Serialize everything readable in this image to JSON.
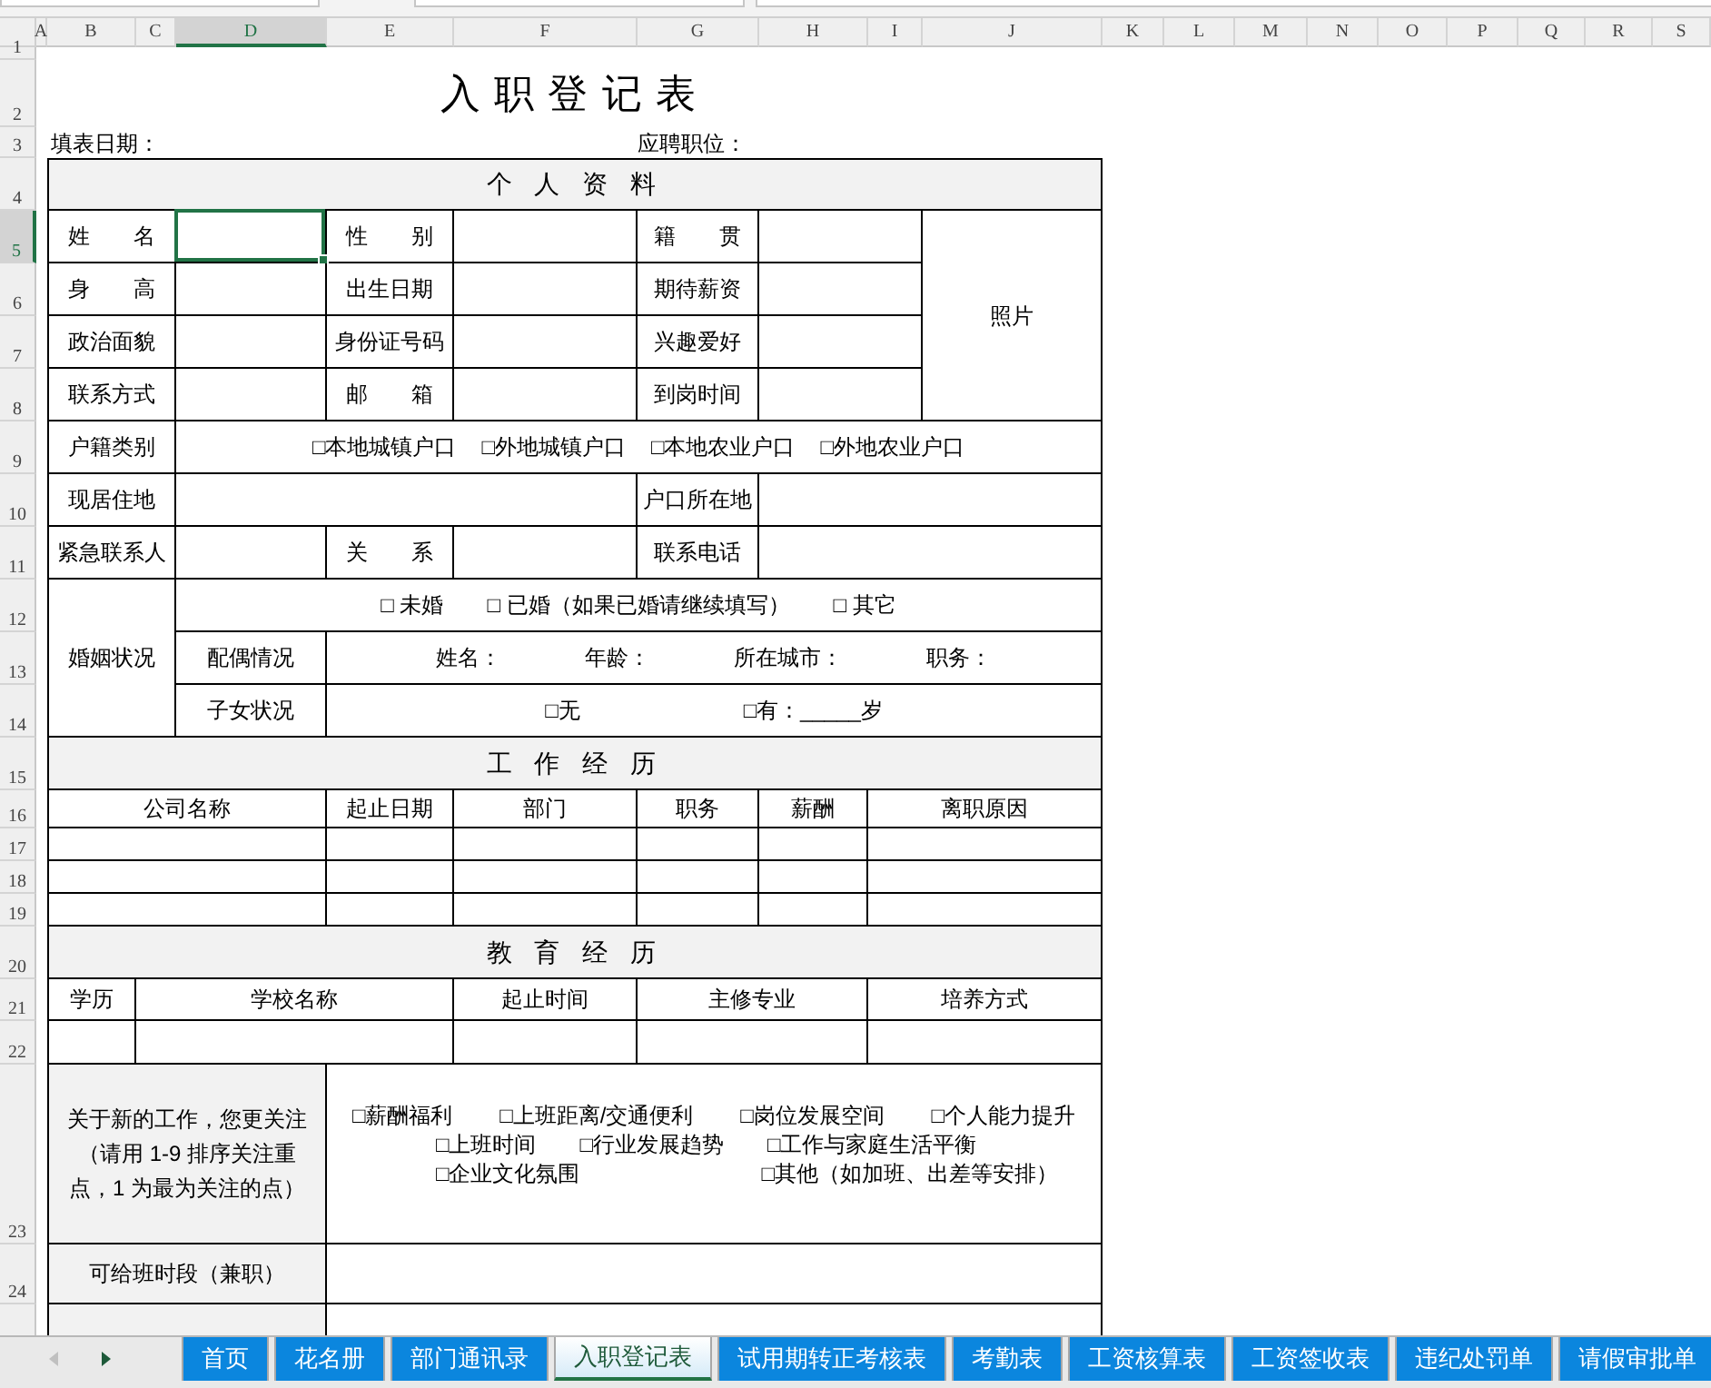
{
  "column_headers": [
    {
      "label": "A",
      "selected": false
    },
    {
      "label": "B",
      "selected": false
    },
    {
      "label": "C",
      "selected": false
    },
    {
      "label": "D",
      "selected": true
    },
    {
      "label": "E",
      "selected": false
    },
    {
      "label": "F",
      "selected": false
    },
    {
      "label": "G",
      "selected": false
    },
    {
      "label": "H",
      "selected": false
    },
    {
      "label": "I",
      "selected": false
    },
    {
      "label": "J",
      "selected": false
    },
    {
      "label": "K",
      "selected": false
    },
    {
      "label": "L",
      "selected": false
    },
    {
      "label": "M",
      "selected": false
    },
    {
      "label": "N",
      "selected": false
    },
    {
      "label": "O",
      "selected": false
    },
    {
      "label": "P",
      "selected": false
    },
    {
      "label": "Q",
      "selected": false
    },
    {
      "label": "R",
      "selected": false
    },
    {
      "label": "S",
      "selected": false
    }
  ],
  "row_headers": [
    {
      "label": "1",
      "selected": false
    },
    {
      "label": "2",
      "selected": false
    },
    {
      "label": "3",
      "selected": false
    },
    {
      "label": "4",
      "selected": false
    },
    {
      "label": "5",
      "selected": true
    },
    {
      "label": "6",
      "selected": false
    },
    {
      "label": "7",
      "selected": false
    },
    {
      "label": "8",
      "selected": false
    },
    {
      "label": "9",
      "selected": false
    },
    {
      "label": "10",
      "selected": false
    },
    {
      "label": "11",
      "selected": false
    },
    {
      "label": "12",
      "selected": false
    },
    {
      "label": "13",
      "selected": false
    },
    {
      "label": "14",
      "selected": false
    },
    {
      "label": "15",
      "selected": false
    },
    {
      "label": "16",
      "selected": false
    },
    {
      "label": "17",
      "selected": false
    },
    {
      "label": "18",
      "selected": false
    },
    {
      "label": "19",
      "selected": false
    },
    {
      "label": "20",
      "selected": false
    },
    {
      "label": "21",
      "selected": false
    },
    {
      "label": "22",
      "selected": false
    },
    {
      "label": "23",
      "selected": false
    },
    {
      "label": "24",
      "selected": false
    }
  ],
  "cells": [
    {
      "kind": "title",
      "text": "入职登记表"
    },
    {
      "kind": "text",
      "text": "填表日期："
    },
    {
      "kind": "text",
      "text": "应聘职位："
    },
    {
      "kind": "heading",
      "text": "个 人 资 料"
    },
    {
      "kind": "text",
      "text": "姓　　名"
    },
    {
      "kind": "text",
      "text": "性　　别"
    },
    {
      "kind": "text",
      "text": "籍　　贯"
    },
    {
      "kind": "text",
      "text": "身　　高"
    },
    {
      "kind": "text",
      "text": "出生日期"
    },
    {
      "kind": "text",
      "text": "期待薪资"
    },
    {
      "kind": "text",
      "text": "政治面貌"
    },
    {
      "kind": "text",
      "text": "身份证号码"
    },
    {
      "kind": "text",
      "text": "兴趣爱好"
    },
    {
      "kind": "text",
      "text": "联系方式"
    },
    {
      "kind": "text",
      "text": "邮　　箱"
    },
    {
      "kind": "text",
      "text": "到岗时间"
    },
    {
      "kind": "text",
      "text": "照片"
    },
    {
      "kind": "text",
      "text": "户籍类别"
    },
    {
      "kind": "options",
      "options": [
        "□本地城镇户口",
        "□外地城镇户口",
        "□本地农业户口",
        "□外地农业户口"
      ]
    },
    {
      "kind": "text",
      "text": "现居住地"
    },
    {
      "kind": "text",
      "text": "户口所在地"
    },
    {
      "kind": "text",
      "text": "紧急联系人"
    },
    {
      "kind": "text",
      "text": "关　　系"
    },
    {
      "kind": "text",
      "text": "联系电话"
    },
    {
      "kind": "text",
      "text": "婚姻状况"
    },
    {
      "kind": "options",
      "options": [
        "□ 未婚",
        "□ 已婚（如果已婚请继续填写）",
        "□ 其它"
      ]
    },
    {
      "kind": "text",
      "text": "配偶情况"
    },
    {
      "kind": "options",
      "options": [
        "姓名：",
        "年龄：",
        "所在城市：",
        "职务："
      ]
    },
    {
      "kind": "text",
      "text": "子女状况"
    },
    {
      "kind": "options",
      "options": [
        "□无",
        "□有：_____岁"
      ]
    },
    {
      "kind": "heading",
      "text": "工 作 经 历"
    },
    {
      "kind": "text",
      "text": "公司名称"
    },
    {
      "kind": "text",
      "text": "起止日期"
    },
    {
      "kind": "text",
      "text": "部门"
    },
    {
      "kind": "text",
      "text": "职务"
    },
    {
      "kind": "text",
      "text": "薪酬"
    },
    {
      "kind": "text",
      "text": "离职原因"
    },
    {
      "kind": "heading",
      "text": "教 育 经 历"
    },
    {
      "kind": "text",
      "text": "学历"
    },
    {
      "kind": "text",
      "text": "学校名称"
    },
    {
      "kind": "text",
      "text": "起止时间"
    },
    {
      "kind": "text",
      "text": "主修专业"
    },
    {
      "kind": "text",
      "text": "培养方式"
    },
    {
      "kind": "text",
      "text": "关于新的工作，您更关注（请用 1-9 排序关注重点，1 为最为关注的点）"
    },
    {
      "kind": "option_lines",
      "lines": [
        [
          "□薪酬福利",
          "□上班距离/交通便利",
          "□岗位发展空间",
          "□个人能力提升"
        ],
        [
          "□上班时间",
          "□行业发展趋势",
          "□工作与家庭生活平衡"
        ],
        [
          "□企业文化氛围",
          "□其他（如加班、出差等安排）"
        ]
      ]
    },
    {
      "kind": "text",
      "text": "可给班时段（兼职）"
    }
  ],
  "sheet_tabs": [
    {
      "label": "首页",
      "selected": false
    },
    {
      "label": "花名册",
      "selected": false
    },
    {
      "label": "部门通讯录",
      "selected": false
    },
    {
      "label": "入职登记表",
      "selected": true
    },
    {
      "label": "试用期转正考核表",
      "selected": false
    },
    {
      "label": "考勤表",
      "selected": false
    },
    {
      "label": "工资核算表",
      "selected": false
    },
    {
      "label": "工资签收表",
      "selected": false
    },
    {
      "label": "违纪处罚单",
      "selected": false
    },
    {
      "label": "请假审批单",
      "selected": false
    }
  ]
}
